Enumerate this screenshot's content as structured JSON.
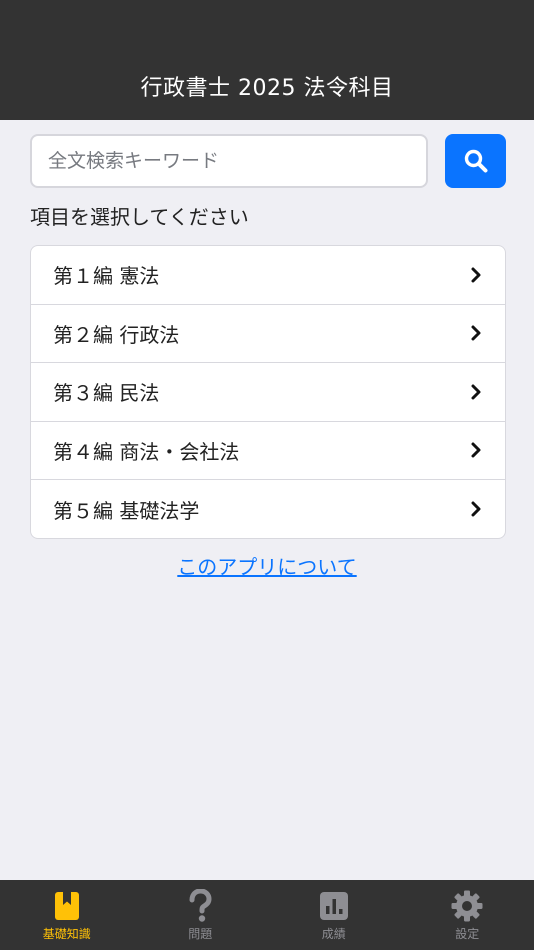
{
  "header": {
    "title": "行政書士 2025 法令科目"
  },
  "search": {
    "placeholder": "全文検索キーワード",
    "value": ""
  },
  "section_label": "項目を選択してください",
  "list": {
    "items": [
      {
        "label": "第１編 憲法"
      },
      {
        "label": "第２編 行政法"
      },
      {
        "label": "第３編 民法"
      },
      {
        "label": "第４編 商法・会社法"
      },
      {
        "label": "第５編 基礎法学"
      }
    ]
  },
  "about_link": "このアプリについて",
  "tabbar": {
    "tabs": [
      {
        "label": "基礎知識",
        "icon": "bookmark-book-icon",
        "active": true
      },
      {
        "label": "問題",
        "icon": "question-mark-icon",
        "active": false
      },
      {
        "label": "成績",
        "icon": "bar-chart-icon",
        "active": false
      },
      {
        "label": "設定",
        "icon": "gear-icon",
        "active": false
      }
    ]
  },
  "colors": {
    "header_bg": "#333333",
    "page_bg": "#efeff4",
    "accent": "#0a74ff",
    "active_tab": "#ffc107",
    "inactive_tab": "#8e8e93"
  }
}
